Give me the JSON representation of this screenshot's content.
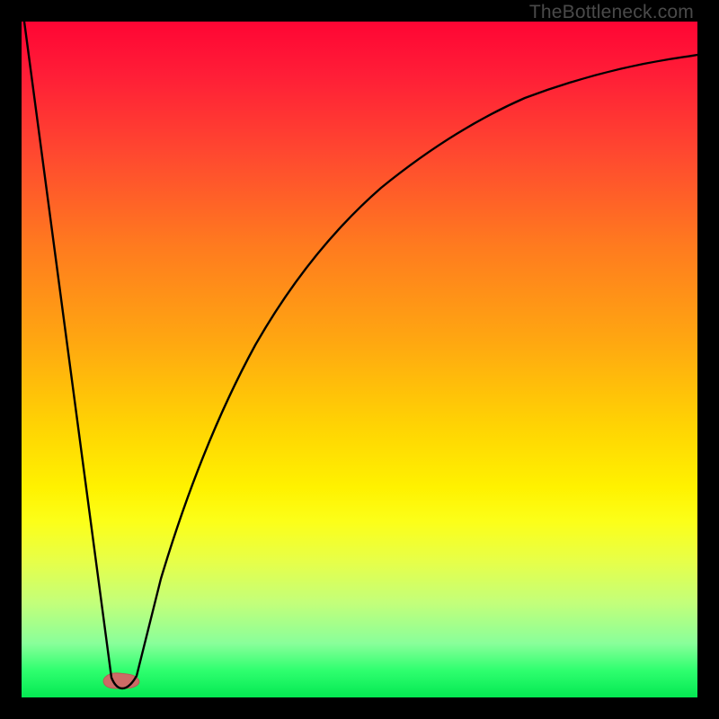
{
  "watermark": "TheBottleneck.com",
  "chart_data": {
    "type": "line",
    "title": "",
    "xlabel": "",
    "ylabel": "",
    "xlim": [
      0,
      100
    ],
    "ylim": [
      0,
      100
    ],
    "grid": false,
    "legend": false,
    "series": [
      {
        "name": "curve",
        "x": [
          0,
          2,
          4,
          6,
          8,
          10,
          12,
          13,
          14,
          15,
          16,
          17,
          18,
          20,
          22,
          24,
          26,
          28,
          30,
          33,
          36,
          40,
          45,
          50,
          55,
          60,
          66,
          72,
          80,
          88,
          96,
          100
        ],
        "y": [
          100,
          87,
          74,
          61,
          48,
          35,
          22,
          9,
          2,
          2,
          2,
          3,
          8,
          19,
          30,
          40,
          48,
          55,
          61,
          67,
          72,
          77,
          82,
          85,
          87,
          89,
          91,
          92,
          93,
          94,
          94.5,
          95
        ]
      },
      {
        "name": "marker",
        "x": [
          13,
          14,
          15,
          16
        ],
        "y": [
          1.6,
          1.5,
          1.5,
          1.8
        ]
      }
    ],
    "colors": {
      "curve": "#000000",
      "marker": "#cc6b66",
      "gradient_top": "#ff0534",
      "gradient_mid": "#ffd403",
      "gradient_bottom": "#04e852"
    },
    "annotations": []
  }
}
